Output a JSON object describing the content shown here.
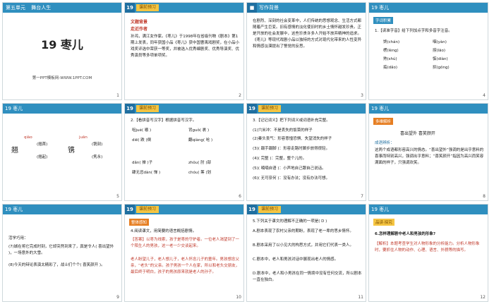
{
  "slides": [
    {
      "no": "1",
      "unit": "第五单元",
      "topic": "舞台人生",
      "title": "19 枣儿",
      "footer": "第一PPT模板网-WWW.1PPT.COM"
    },
    {
      "no": "2",
      "hdr": "19",
      "tag": "课前预习",
      "sec1": "文题背景",
      "sec2": "走近作者",
      "body": "孙鸿，满江女作家。《枣儿》于1998年在省级刊物《剧本》第1期上发表，同年获国小品《枣儿》获中国曹禺戏剧奖，在小品小戏奖评选中荣获一等奖，并被选入优秀编剧奖、优秀导演奖、优秀演员等多项单项奖。"
    },
    {
      "no": "3",
      "hdr": "写作背景",
      "body": "在剧烈、深刻的社会变革中，人们传统的思想观念、生活方式都随着产生巨变。旧有感情的淡化使旧时的乡土情怀越发珍贵。正是开放的社会发展中，这些珍贵许多人开始不放弃精神的追求。《枣儿》等现代戏剧小品以独特的方式对现代化带来的人性变异和情感淡漠提出了警觉的反思。"
    },
    {
      "no": "4",
      "hdr": "19   枣儿",
      "sec": "字词积累",
      "q": "1.【读准字音】给下列加点字和多音字注音。",
      "items": [
        "馋(chán)",
        "咽(yàn)",
        "楞(lèng)",
        "捞(lāo)",
        "熟(shú)",
        "惦(diàn)",
        "捣(dǎo)",
        "拱(gǒng)"
      ]
    },
    {
      "no": "5",
      "hdr": "19   枣儿",
      "w1": "qiào",
      "w1a": "(翘首)",
      "w1b": "(翘起)",
      "w2": "juān",
      "w2a": "(镌刻)",
      "w2b": "(隽永)",
      "c1": "翘",
      "c2": "镌"
    },
    {
      "no": "6",
      "hdr": "19",
      "tag": "课前预习",
      "q": "2.【看拼音写汉字】根据拼音写汉字。",
      "rows": [
        "咀jué( 嚼 )",
        "背guǒ( 裹 )",
        "diē( 跌 )倒",
        "翻qiàng( 呛 )",
        "dǎn( 掸 )子",
        "zhǒu( 肘 )部",
        "肆无忌dàn( 惮 )",
        "chóu( 筹 )划"
      ]
    },
    {
      "no": "7",
      "hdr": "19",
      "tag": "课前预习",
      "q": "3.【记记词义】把下列词义或词语补充完整。",
      "items": [
        "(1)穴米冲：不是丢失的饭菜的样子",
        "(2)秦头丧气：形容意惶恐惧、失望消失的样子",
        "(3)( 蹑手蹑脚 )：形容走路时脚步放得很轻。",
        "(4)( 完整 )：完整，整个儿的。",
        "(5)( 喃喃自语 )：小声地自己跟自己说话。",
        "(6)( 无可奈何 )：没有办法；没有办法可想。"
      ]
    },
    {
      "no": "8",
      "hdr": "19   枣儿",
      "sec": "多维解析",
      "h": "喜出望外    喜笑颜开",
      "label": "成语辨析：",
      "body": "这两个成语都形容高兴的情态。“喜出望外”强调的是出乎意料的喜事而特别高兴，强调出乎意料；“喜笑颜开”指因为高兴而笑容满面的样子，只强调欢笑。"
    },
    {
      "no": "9",
      "hdr": "19   枣儿",
      "label": "活学巧用：",
      "items": [
        "(7)城在将它完成时刻，它却突然到来了，真是令人( 喜出望外 )，一场意外的大雪。",
        "(8)今天的辩论表演太精彩了，战士们个个( 喜笑颜开 )。"
      ]
    },
    {
      "no": "10",
      "hdr": "19",
      "tag": "课前预习",
      "sec": "整体感知",
      "q": "4.阅读课文，用简要的语言概括剧情。",
      "ans": "【答案】以枣为线索，孩子是枣的守护者。一位老人渴望到了一个陌生人的男孩，这一老一少交谈起来。",
      "body": "老人盼望儿子，老人想儿子，老人怀念儿子的童年。男孩想念父亲，“老头”的父亲。孩子男孩一个人在家，所以和老头交朋友，最后终于明白，孩子的男孩原来就是老人的孙子。"
    },
    {
      "no": "11",
      "hdr": "19",
      "tag": "课前预习",
      "q": "5.下列关于课文的理解不正确的一项是( D )",
      "items": [
        "A.剧本表现了农村父亲的期盼，表现了老一辈的思乡情怀。",
        "B.剧本采用了以小见大的构思方式，并用它们代表一类人。",
        "C.剧本中，老人和男孩对话中展现出老人的情感。",
        "D.剧本中，老人和小男孩在同一情境中没有任何交流，所以剧本一直在独白。"
      ]
    },
    {
      "no": "12",
      "hdr": "19   枣儿",
      "tag": "品读·探究",
      "sec": "6.怎样理解剧中老人和男孩的形象?",
      "ans": "【解析】本题考查学生对人物形象的分析能力。分析人物形象时，要抓住人物的动作、心理、语言、外貌等的描写。"
    }
  ]
}
